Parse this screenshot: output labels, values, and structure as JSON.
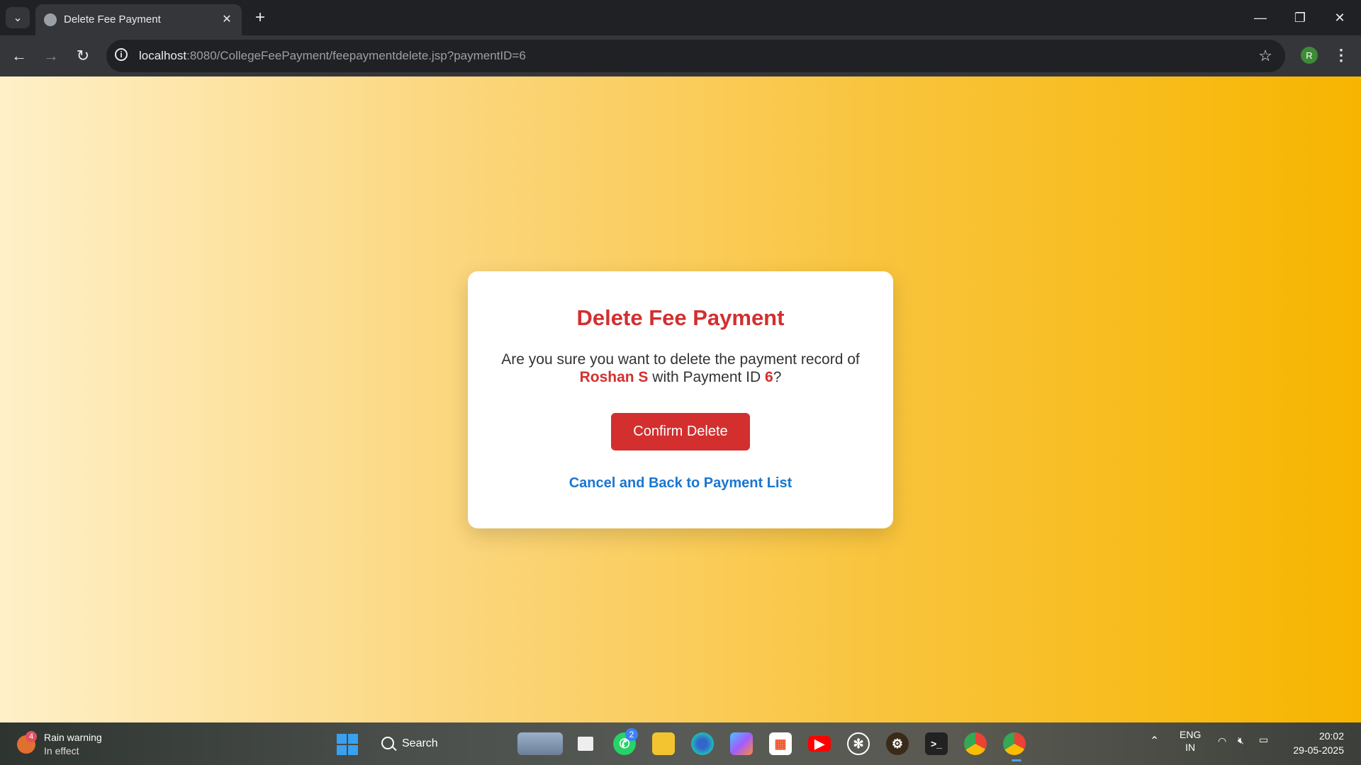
{
  "browser": {
    "tab_title": "Delete Fee Payment",
    "url_host": "localhost",
    "url_rest": ":8080/CollegeFeePayment/feepaymentdelete.jsp?paymentID=6",
    "profile_initial": "R"
  },
  "page": {
    "heading": "Delete Fee Payment",
    "message_prefix": "Are you sure you want to delete the payment record of",
    "student_name": "Roshan S",
    "message_mid": "with Payment ID",
    "payment_id": "6",
    "message_suffix": "?",
    "confirm_label": "Confirm Delete",
    "cancel_label": "Cancel and Back to Payment List",
    "colors": {
      "accent": "#d32f2f",
      "link": "#1976d2"
    }
  },
  "taskbar": {
    "weather_title": "Rain warning",
    "weather_sub": "In effect",
    "weather_badge": "4",
    "search_label": "Search",
    "whatsapp_badge": "2",
    "lang_top": "ENG",
    "lang_bottom": "IN",
    "time": "20:02",
    "date": "29-05-2025",
    "app_icons": [
      "mountain-widget-icon",
      "task-view-icon",
      "whatsapp-icon",
      "file-explorer-icon",
      "edge-icon",
      "copilot-icon",
      "store-icon",
      "youtube-icon",
      "chatgpt-icon",
      "app-gear-icon",
      "terminal-icon",
      "chrome-icon",
      "chrome-profile-icon"
    ]
  }
}
